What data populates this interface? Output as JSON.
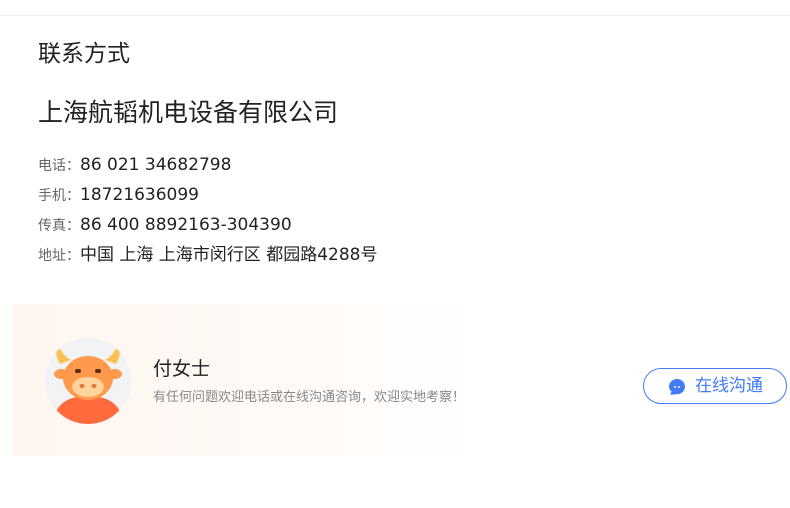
{
  "contact": {
    "section_title": "联系方式",
    "company_name": "上海航韬机电设备有限公司",
    "rows": [
      {
        "label": "电话：",
        "value": "86 021 34682798"
      },
      {
        "label": "手机：",
        "value": "18721636099"
      },
      {
        "label": "传真：",
        "value": "86 400 8892163-304390"
      },
      {
        "label": "地址：",
        "value": "中国 上海 上海市闵行区 都园路4288号"
      }
    ]
  },
  "card": {
    "avatar_icon": "bull-mascot-icon",
    "person_name": "付女士",
    "description": "有任何问题欢迎电话或在线沟通咨询，欢迎实地考察！",
    "button_label": "在线沟通",
    "button_icon": "chat-bubble-icon"
  },
  "colors": {
    "accent_blue": "#3f7cf6",
    "card_tint": "#fff6f0",
    "mascot_orange": "#ff7a3d"
  }
}
